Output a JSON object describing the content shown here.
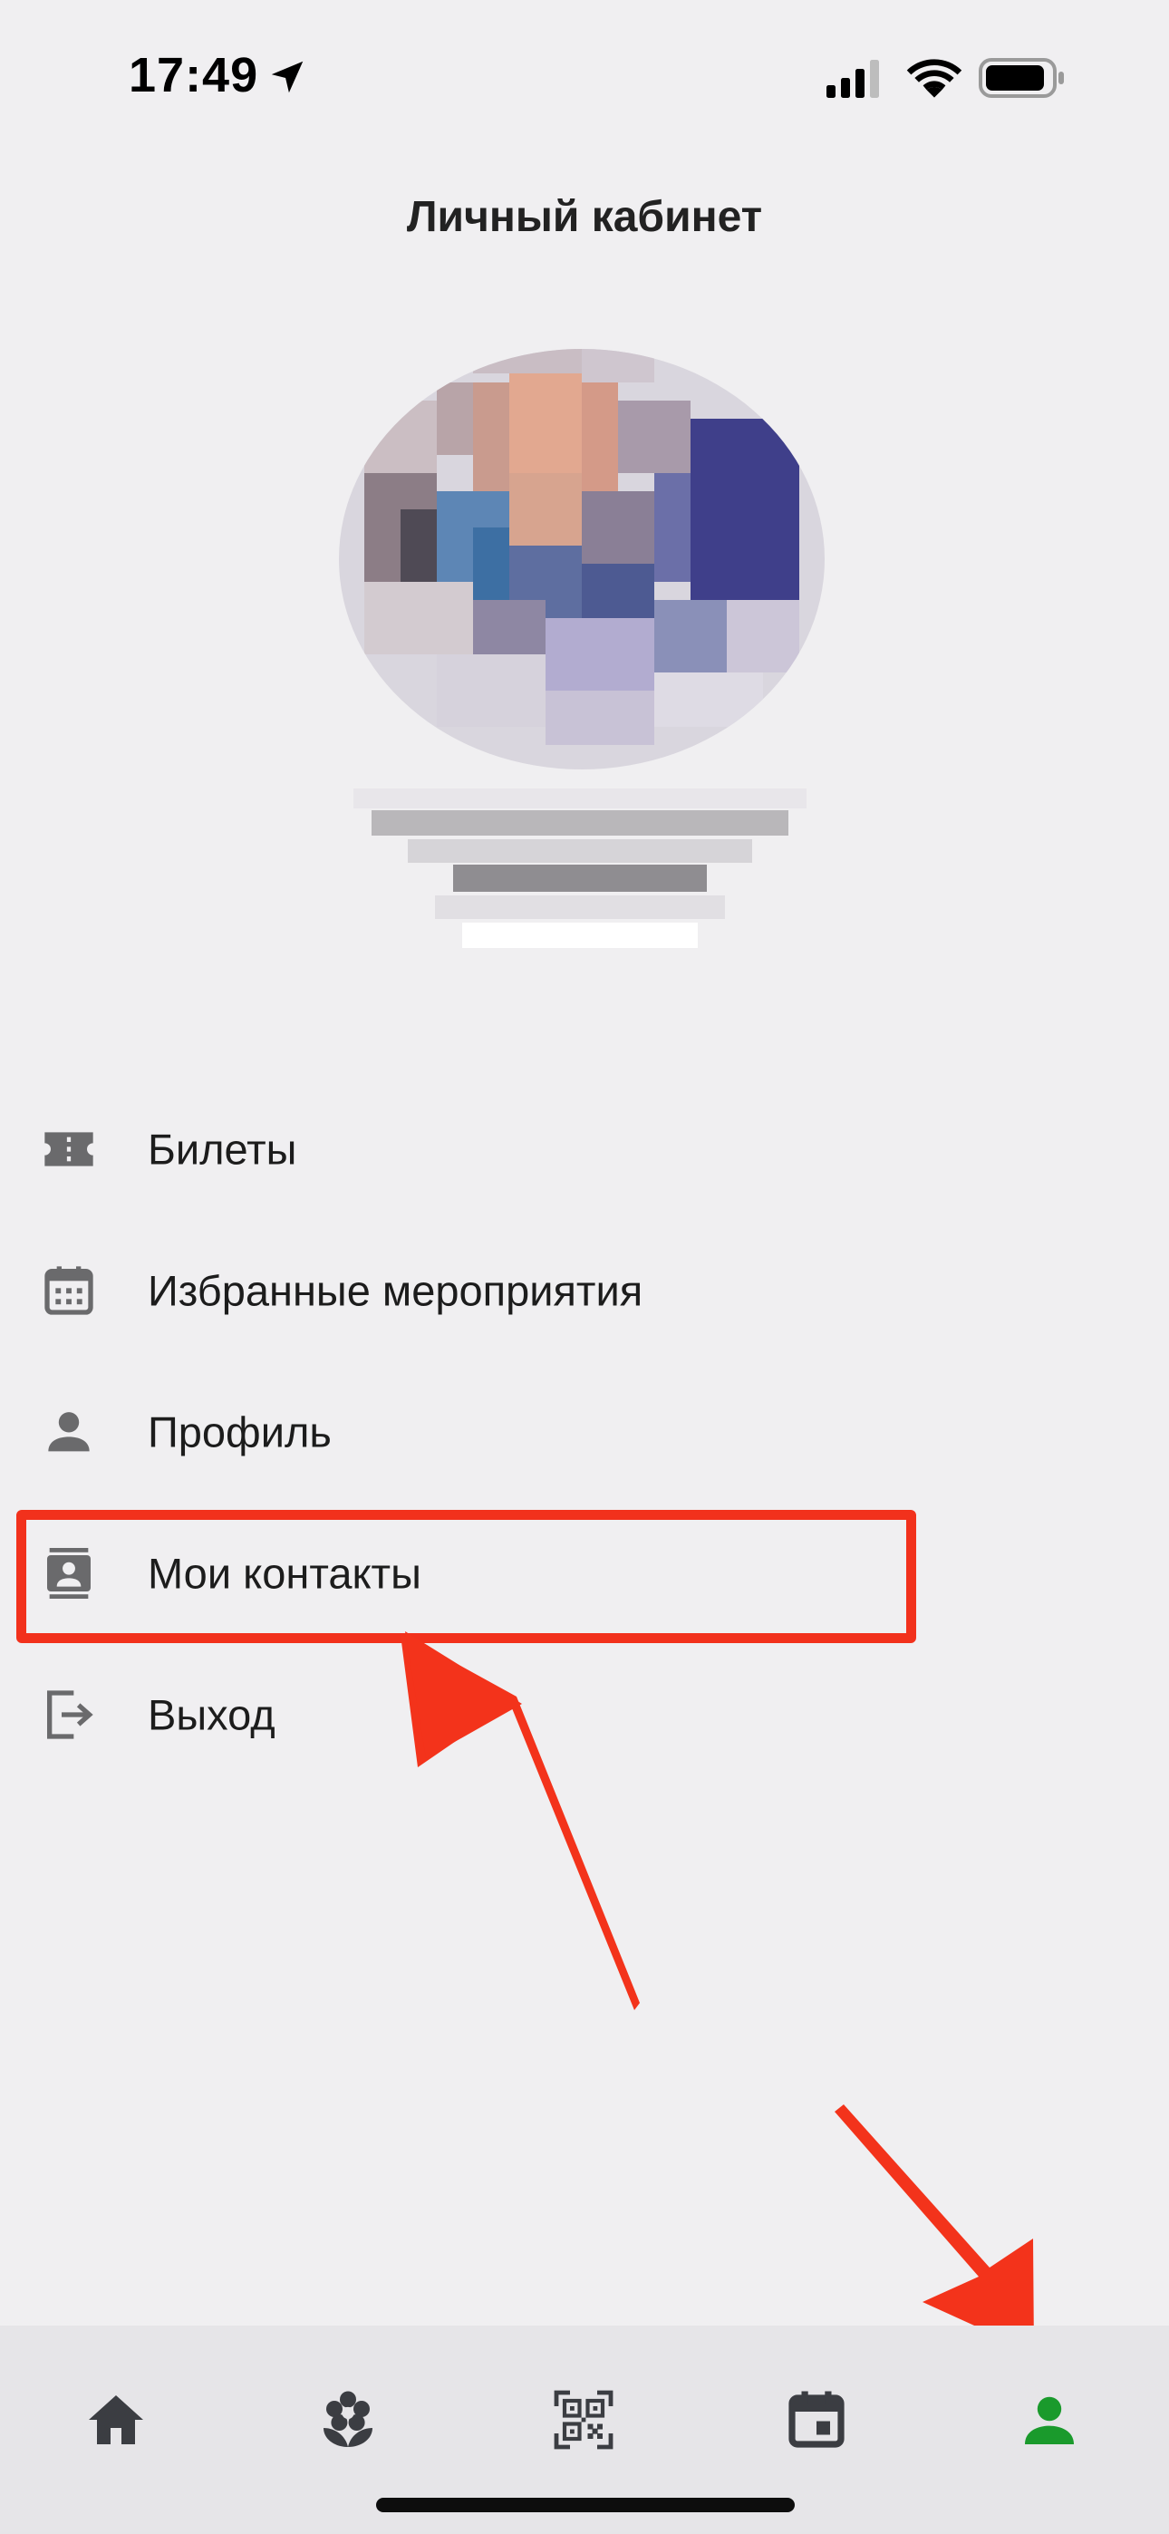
{
  "status_bar": {
    "time": "17:49",
    "icons": [
      "location-icon",
      "cellular-signal-icon",
      "wifi-icon",
      "battery-icon"
    ]
  },
  "header": {
    "title": "Личный кабинет"
  },
  "menu": {
    "items": [
      {
        "label": "Билеты",
        "icon": "ticket-icon"
      },
      {
        "label": "Избранные мероприятия",
        "icon": "calendar-icon"
      },
      {
        "label": "Профиль",
        "icon": "person-icon"
      },
      {
        "label": "Мои контакты",
        "icon": "contacts-icon"
      },
      {
        "label": "Выход",
        "icon": "logout-icon"
      }
    ]
  },
  "tab_bar": {
    "tabs": [
      {
        "name": "home",
        "icon": "home-icon",
        "active": false
      },
      {
        "name": "flower",
        "icon": "flower-icon",
        "active": false
      },
      {
        "name": "qr",
        "icon": "qr-code-icon",
        "active": false
      },
      {
        "name": "calendar",
        "icon": "calendar-event-icon",
        "active": false
      },
      {
        "name": "profile",
        "icon": "person-icon",
        "active": true
      }
    ],
    "active_color": "#1a9a2c",
    "inactive_color": "#3b3d42"
  },
  "annotations": {
    "highlight_color": "#f2311c"
  }
}
